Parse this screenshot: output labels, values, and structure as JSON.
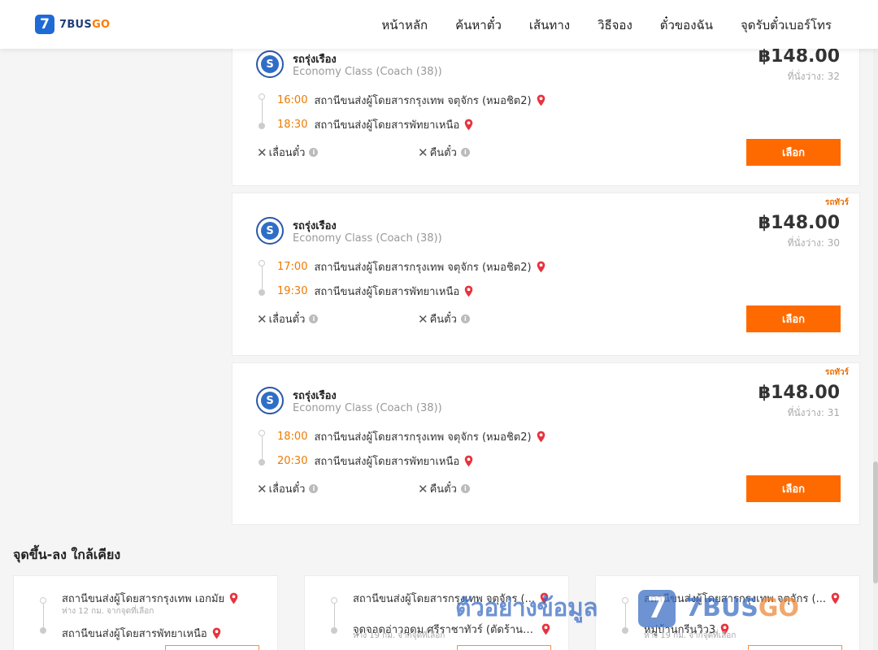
{
  "header": {
    "logo_digit": "7",
    "logo_text": "7BUS",
    "logo_text_accent": "GO",
    "nav": [
      "หน้าหลัก",
      "ค้นหาตั๋ว",
      "เส้นทาง",
      "วิธีจอง",
      "ตั๋วของฉัน",
      "จุดรับตั๋วเบอร์โทร"
    ]
  },
  "trips": [
    {
      "tag": "",
      "operator": "รถรุ่งเรือง",
      "class": "Economy Class (Coach (38))",
      "price": "฿148.00",
      "seats": "ที่นั่งว่าง: 32",
      "depart_time": "16:00",
      "depart_station": "สถานีขนส่งผู้โดยสารกรุงเทพ จตุจักร (หมอชิต2)",
      "arrive_time": "18:30",
      "arrive_station": "สถานีขนส่งผู้โดยสารพัทยาเหนือ",
      "reschedule": "เลื่อนตั๋ว",
      "refund": "คืนตั๋ว",
      "select": "เลือก"
    },
    {
      "tag": "รถทัวร์",
      "operator": "รถรุ่งเรือง",
      "class": "Economy Class (Coach (38))",
      "price": "฿148.00",
      "seats": "ที่นั่งว่าง: 30",
      "depart_time": "17:00",
      "depart_station": "สถานีขนส่งผู้โดยสารกรุงเทพ จตุจักร (หมอชิต2)",
      "arrive_time": "19:30",
      "arrive_station": "สถานีขนส่งผู้โดยสารพัทยาเหนือ",
      "reschedule": "เลื่อนตั๋ว",
      "refund": "คืนตั๋ว",
      "select": "เลือก"
    },
    {
      "tag": "รถทัวร์",
      "operator": "รถรุ่งเรือง",
      "class": "Economy Class (Coach (38))",
      "price": "฿148.00",
      "seats": "ที่นั่งว่าง: 31",
      "depart_time": "18:00",
      "depart_station": "สถานีขนส่งผู้โดยสารกรุงเทพ จตุจักร (หมอชิต2)",
      "arrive_time": "20:30",
      "arrive_station": "สถานีขนส่งผู้โดยสารพัทยาเหนือ",
      "reschedule": "เลื่อนตั๋ว",
      "refund": "คืนตั๋ว",
      "select": "เลือก"
    }
  ],
  "nearby": {
    "title": "จุดขึ้น-ลง ใกล้เคียง",
    "items": [
      {
        "from": "สถานีขนส่งผู้โดยสารกรุงเทพ เอกมัย",
        "from_dist": "ห่าง 12 กม. จากจุดที่เลือก",
        "to": "สถานีขนส่งผู้โดยสารพัทยาเหนือ",
        "to_dist": ""
      },
      {
        "from": "สถานีขนส่งผู้โดยสารกรุงเทพ จตุจักร (...",
        "from_dist": "",
        "to": "จุดจอดอ่าวอุดม ศรีราชาทัวร์ (ตัดร้านท...",
        "to_dist": "ห่าง 19 กม. จากจุดที่เลือก"
      },
      {
        "from": "สถานีขนส่งผู้โดยสารกรุงเทพ จตุจักร (...",
        "from_dist": "",
        "to": "หมู่บ้านกรีนวิว3",
        "to_dist": "ห่าง 19 กม. จากจุดที่เลือก"
      }
    ]
  },
  "watermark": {
    "text": "ตัวอย่างข้อมูล",
    "logo_digit": "7",
    "brand": "7BUS",
    "brand_accent": "GO"
  },
  "colors": {
    "accent": "#ff6a00",
    "time": "#ee7a00",
    "brand_blue": "#1f6bd6",
    "pin": "#e8323c"
  }
}
